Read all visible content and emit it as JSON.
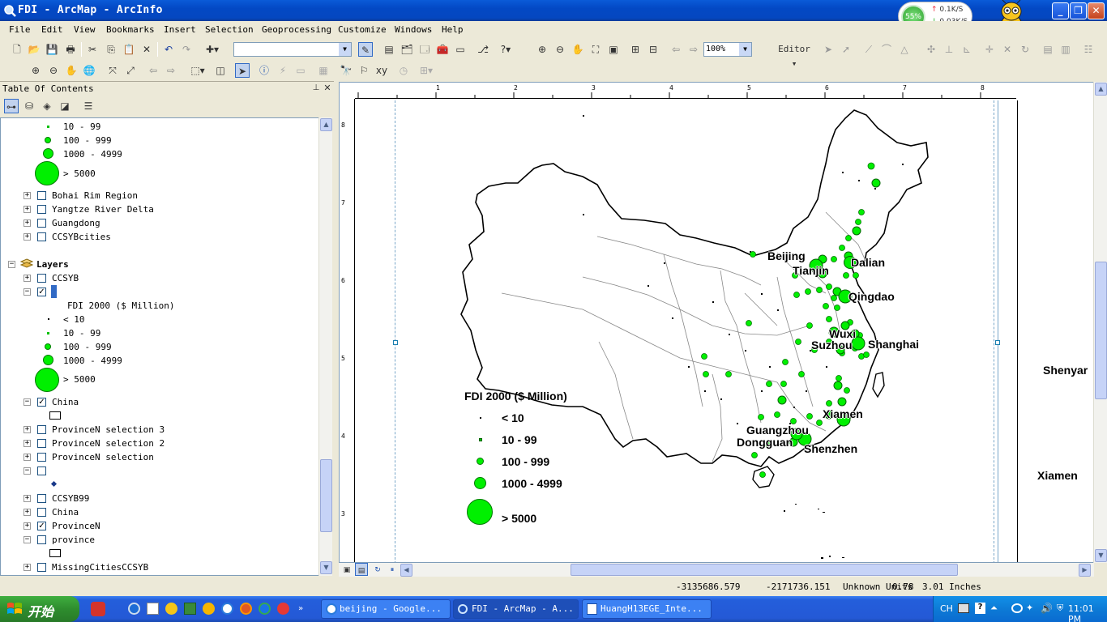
{
  "window": {
    "title": "FDI - ArcMap - ArcInfo",
    "minimize_label": "_",
    "maximize_label": "❐",
    "close_label": "✕"
  },
  "netmeter": {
    "percent": "55%",
    "up": "0.1K/S",
    "down": "0.03K/S"
  },
  "menu": [
    "File",
    "Edit",
    "View",
    "Bookmarks",
    "Insert",
    "Selection",
    "Geoprocessing",
    "Customize",
    "Windows",
    "Help"
  ],
  "toolbar": {
    "zoom_value": "100%",
    "editor_label": "Editor ▾"
  },
  "toc": {
    "title": "Table Of Contents",
    "legend_top": [
      "10 - 99",
      "100 - 999",
      "1000 - 4999",
      "> 5000"
    ],
    "groups": [
      "Bohai Rim Region",
      "Yangtze River Delta",
      "Guangdong",
      "CCSYBcities"
    ],
    "layers_label": "Layers",
    "ccsyb": "CCSYB",
    "fdi_heading": "FDI 2000 ($ Million)",
    "fdi_classes": [
      "< 10",
      "10 - 99",
      "100 - 999",
      "1000 - 4999",
      "> 5000"
    ],
    "china": "China",
    "selections": [
      "ProvinceN selection 3",
      "ProvinceN selection 2",
      "ProvinceN selection"
    ],
    "layers_bottom": [
      "CCSYB99",
      "China",
      "ProvinceN",
      "province",
      "MissingCitiesCCSYB"
    ]
  },
  "map": {
    "ruler_top": [
      "1",
      "2",
      "3",
      "4",
      "5",
      "6",
      "7",
      "8"
    ],
    "ruler_left": [
      "8",
      "7",
      "6",
      "5",
      "4",
      "3"
    ],
    "legend_title": "FDI 2000 ($ Million)",
    "legend_classes": [
      "< 10",
      "10 - 99",
      "100 - 999",
      "1000 - 4999",
      "> 5000"
    ],
    "cities": [
      "Beijing",
      "Tianjin",
      "Dalian",
      "Qingdao",
      "Wuxi",
      "Suzhou",
      "Shanghai",
      "Xiamen",
      "Guangzhou",
      "Dongguan",
      "Shenzhen"
    ],
    "offpage_labels": [
      "Shenyar",
      "Xiamen"
    ]
  },
  "status": {
    "x": "-3135686.579",
    "y": "-2171736.151",
    "units": "Unknown Units",
    "page_x": "0.78",
    "page_y": "3.01 Inches"
  },
  "taskbar": {
    "start": "开始",
    "items": [
      "beijing - Google...",
      "FDI - ArcMap - A...",
      "HuangH13EGE_Inte..."
    ],
    "lang": "CH",
    "clock": "11:01 PM"
  }
}
